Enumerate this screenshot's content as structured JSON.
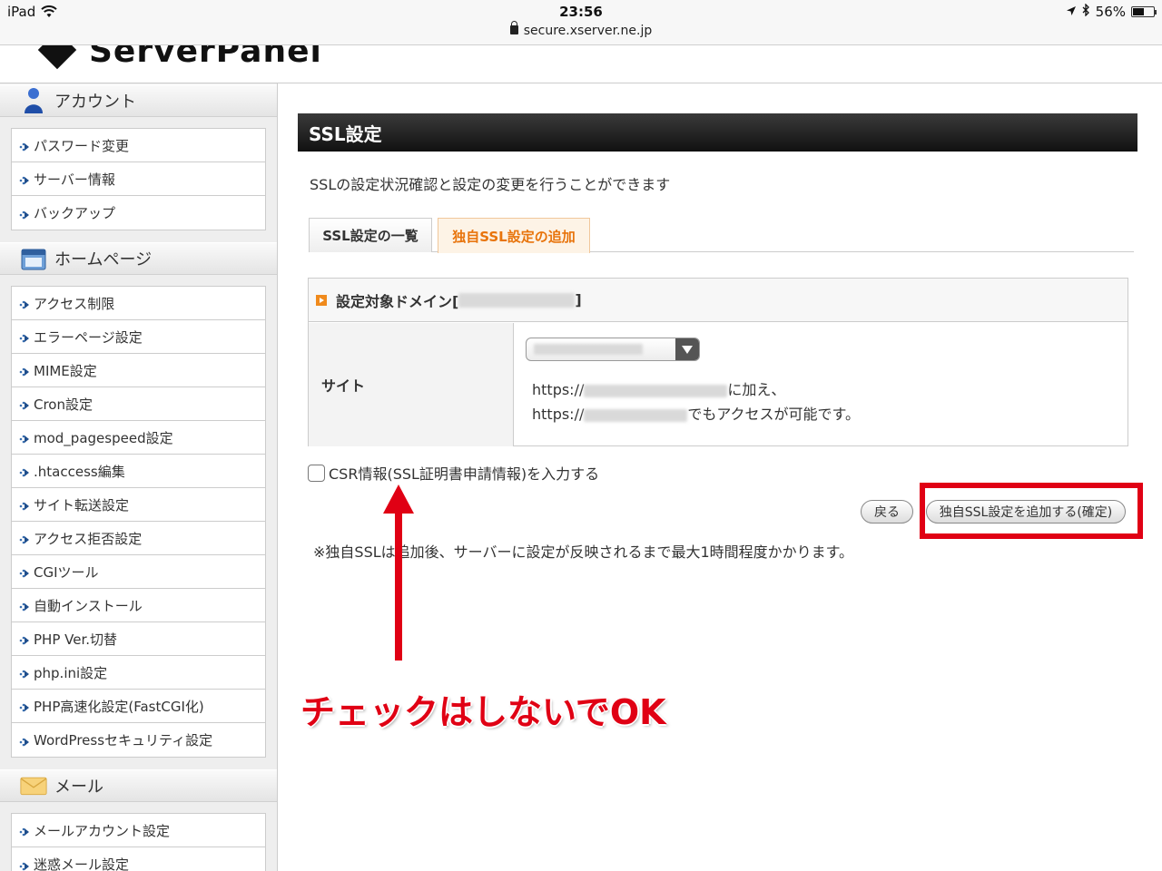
{
  "status_bar": {
    "device": "iPad",
    "time": "23:56",
    "url": "secure.xserver.ne.jp",
    "battery": "56%",
    "battery_level": 0.56
  },
  "header": {
    "logo": "ServerPanel"
  },
  "sidebar": {
    "sections": [
      {
        "title": "アカウント",
        "icon": "person-icon",
        "items": [
          "パスワード変更",
          "サーバー情報",
          "バックアップ"
        ]
      },
      {
        "title": "ホームページ",
        "icon": "window-icon",
        "items": [
          "アクセス制限",
          "エラーページ設定",
          "MIME設定",
          "Cron設定",
          "mod_pagespeed設定",
          ".htaccess編集",
          "サイト転送設定",
          "アクセス拒否設定",
          "CGIツール",
          "自動インストール",
          "PHP Ver.切替",
          "php.ini設定",
          "PHP高速化設定(FastCGI化)",
          "WordPressセキュリティ設定"
        ]
      },
      {
        "title": "メール",
        "icon": "envelope-icon",
        "items": [
          "メールアカウント設定",
          "迷惑メール設定"
        ]
      }
    ]
  },
  "main": {
    "title": "SSL設定",
    "description": "SSLの設定状況確認と設定の変更を行うことができます",
    "tabs": [
      {
        "label": "SSL設定の一覧",
        "active": false
      },
      {
        "label": "独自SSL設定の追加",
        "active": true
      }
    ],
    "form": {
      "heading_prefix": "設定対象ドメイン[",
      "heading_suffix": "]",
      "row_label": "サイト",
      "url_prefix_1": "https://",
      "url_suffix_1": "に加え、",
      "url_prefix_2": "https://",
      "url_suffix_2": "でもアクセスが可能です。"
    },
    "csr_label": "CSR情報(SSL証明書申請情報)を入力する",
    "back_button": "戻る",
    "submit_button": "独自SSL設定を追加する(確定)",
    "note": "※独自SSLは追加後、サーバーに設定が反映されるまで最大1時間程度かかります。"
  },
  "annotation": {
    "text": "チェックはしないでOK",
    "color": "#e00014"
  }
}
